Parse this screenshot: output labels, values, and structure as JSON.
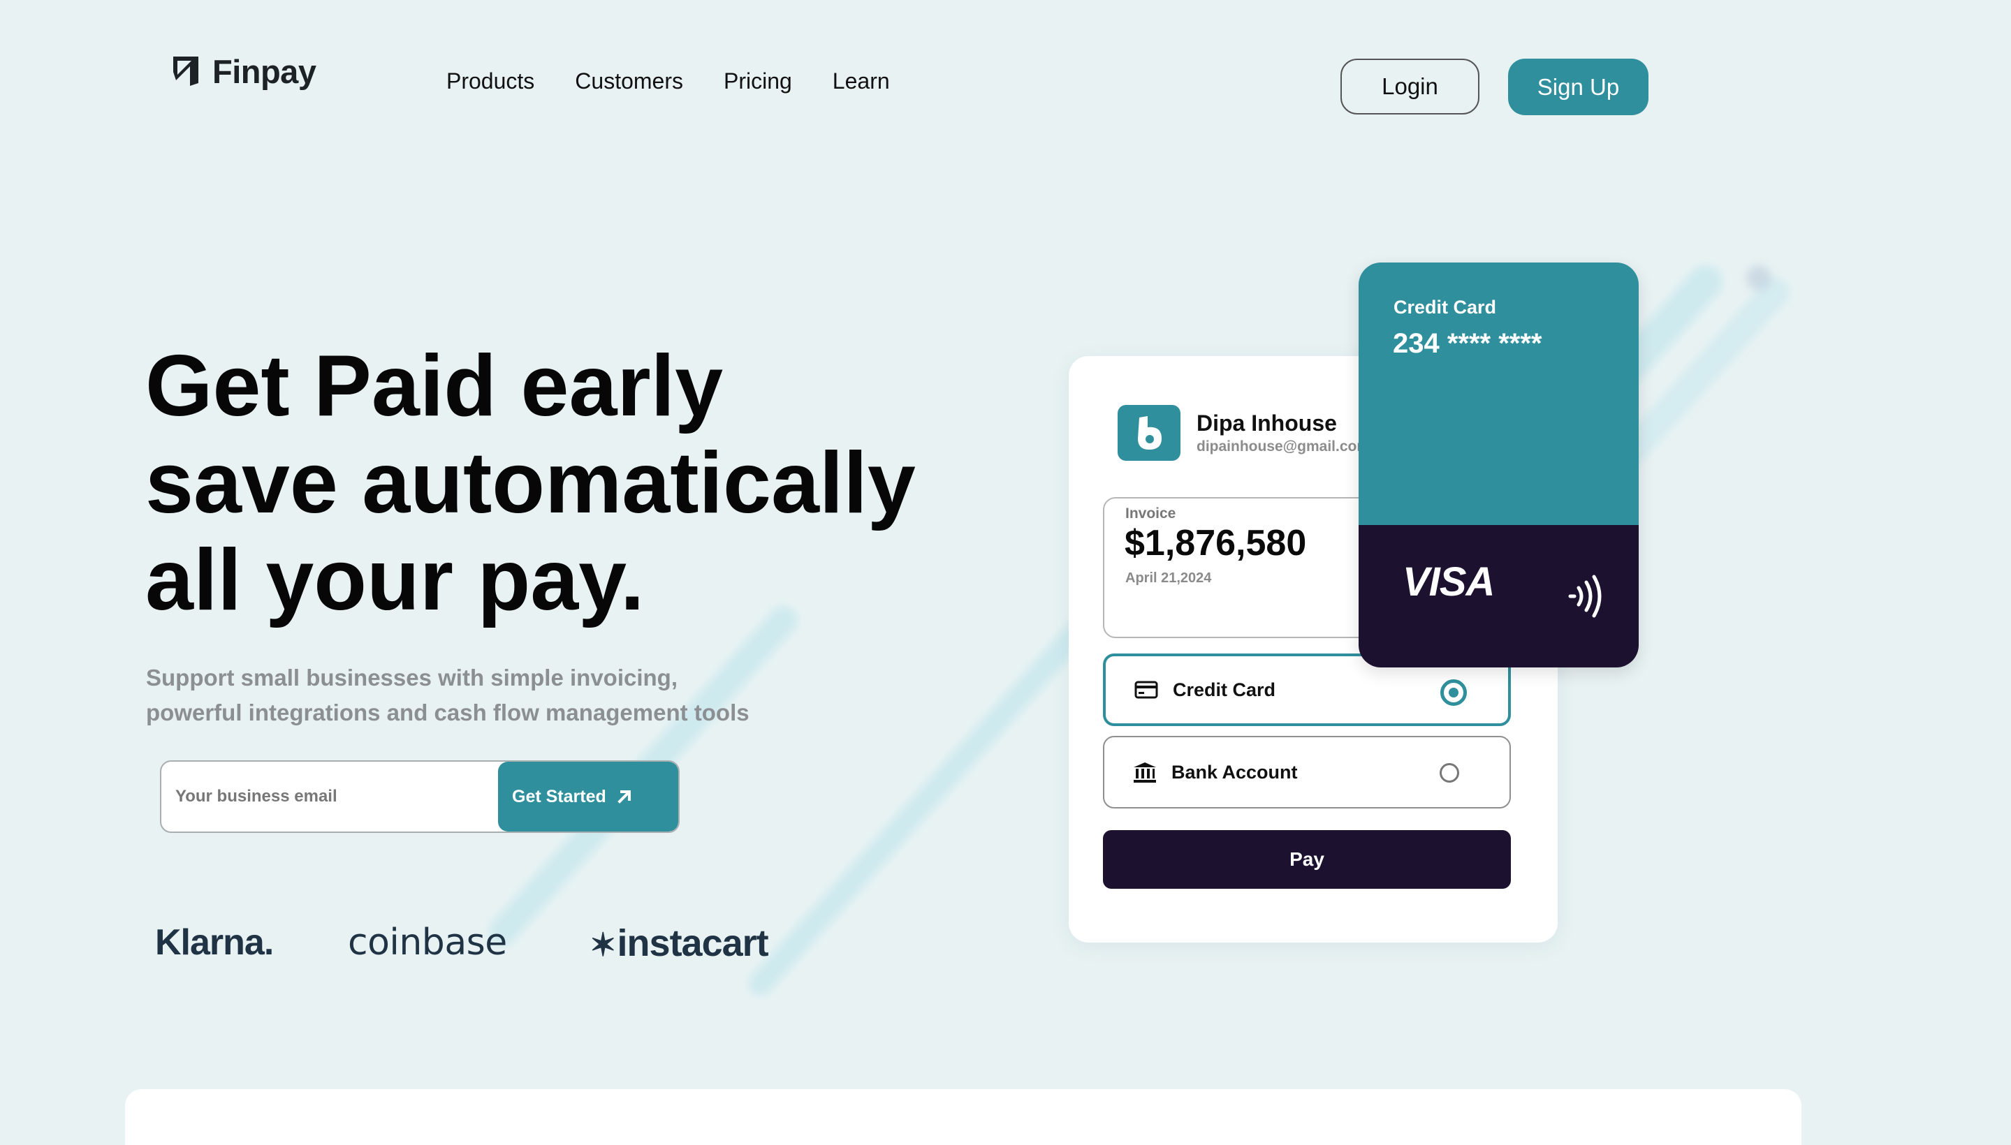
{
  "app": {
    "name": "Finpay",
    "colors": {
      "accent": "#2f8f9c",
      "dark": "#1c1230",
      "background": "#e8f2f3"
    }
  },
  "nav": {
    "items": [
      "Products",
      "Customers",
      "Pricing",
      "Learn"
    ],
    "login_label": "Login",
    "signup_label": "Sign Up"
  },
  "hero": {
    "title_lines": [
      "Get Paid early",
      "save automatically",
      "all your pay."
    ],
    "subtitle_lines": [
      "Support small businesses with simple invoicing,",
      "powerful integrations and cash flow management tools"
    ],
    "email_placeholder": "Your business email",
    "cta_label": "Get Started"
  },
  "brands": [
    "Klarna.",
    "coinbase",
    "instacart"
  ],
  "payment": {
    "user_name": "Dipa Inhouse",
    "user_email": "dipainhouse@gmail.com",
    "invoice_label": "Invoice",
    "invoice_amount": "$1,876,580",
    "invoice_date": "April 21,2024",
    "options": [
      "Credit Card",
      "Bank Account"
    ],
    "selected_option": "Credit Card",
    "pay_label": "Pay"
  },
  "card": {
    "title": "Credit Card",
    "number": "234 **** ****",
    "network": "VISA"
  },
  "icons": [
    "finpay-logo-icon",
    "arrow-up-right-icon",
    "credit-card-icon",
    "bank-icon",
    "contactless-icon",
    "dipa-logo-icon"
  ]
}
